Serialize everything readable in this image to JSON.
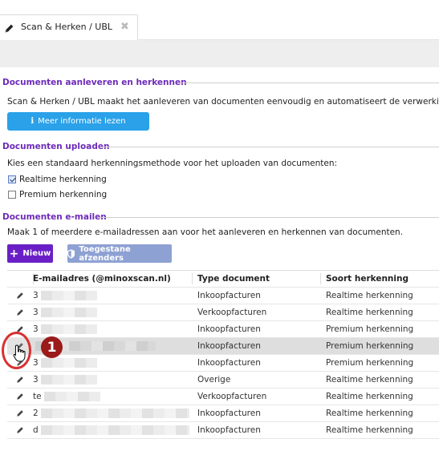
{
  "tab": {
    "title": "Scan & Herken / UBL",
    "close": "✖"
  },
  "sections": {
    "aanleveren": {
      "title": "Documenten aanleveren en herkennen",
      "text": "Scan & Herken / UBL maakt het aanleveren van documenten eenvoudig en automatiseert de verwerking in",
      "button": "Meer informatie lezen"
    },
    "uploaden": {
      "title": "Documenten uploaden",
      "text": "Kies een standaard herkenningsmethode voor het uploaden van documenten:",
      "options": [
        {
          "label": "Realtime herkenning",
          "checked": true
        },
        {
          "label": "Premium herkenning",
          "checked": false
        }
      ]
    },
    "emailen": {
      "title": "Documenten e-mailen",
      "text": "Maak 1 of meerdere e-mailadressen aan voor het aanleveren en herkennen van documenten.",
      "new_button": "Nieuw",
      "senders_button": "Toegestane afzenders"
    }
  },
  "table": {
    "headers": [
      "E-mailadres (@minoxscan.nl)",
      "Type document",
      "Soort herkenning"
    ],
    "rows": [
      {
        "email": "3",
        "type": "Inkoopfacturen",
        "recognition": "Realtime herkenning"
      },
      {
        "email": "3",
        "type": "Verkoopfacturen",
        "recognition": "Realtime herkenning"
      },
      {
        "email": "3",
        "type": "Inkoopfacturen",
        "recognition": "Premium herkenning"
      },
      {
        "email": "",
        "type": "Inkoopfacturen",
        "recognition": "Premium herkenning",
        "highlight": true
      },
      {
        "email": "3",
        "type": "Inkoopfacturen",
        "recognition": "Premium herkenning"
      },
      {
        "email": "3",
        "type": "Overige",
        "recognition": "Realtime herkenning"
      },
      {
        "email": "te",
        "type": "Verkoopfacturen",
        "recognition": "Realtime herkenning"
      },
      {
        "email": "2",
        "type": "Inkoopfacturen",
        "recognition": "Realtime herkenning"
      },
      {
        "email": "d",
        "type": "Inkoopfacturen",
        "recognition": "Realtime herkenning"
      }
    ]
  },
  "callout": {
    "number": "1"
  },
  "colors": {
    "section_title": "#6d2bb8",
    "info_button": "#2aa1e8",
    "new_button": "#6a1fc6",
    "senders_button": "#8ea1d3",
    "callout": "#d93030"
  }
}
